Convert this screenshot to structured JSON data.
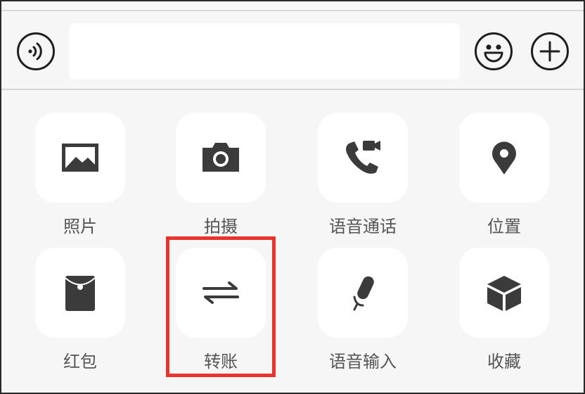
{
  "input_bar": {
    "voice_icon": "voice-wave-icon",
    "message_value": "",
    "emoji_icon": "smiley-face-icon",
    "more_icon": "plus-circle-icon"
  },
  "panel": {
    "items": [
      {
        "label": "照片",
        "icon": "image-icon"
      },
      {
        "label": "拍摄",
        "icon": "camera-icon"
      },
      {
        "label": "语音通话",
        "icon": "phone-video-icon"
      },
      {
        "label": "位置",
        "icon": "location-pin-icon"
      },
      {
        "label": "红包",
        "icon": "red-envelope-icon"
      },
      {
        "label": "转账",
        "icon": "transfer-arrows-icon"
      },
      {
        "label": "语音输入",
        "icon": "microphone-icon"
      },
      {
        "label": "收藏",
        "icon": "favorites-cube-icon"
      }
    ]
  },
  "colors": {
    "background": "#f6f6f6",
    "tile": "#ffffff",
    "icon": "#3b3b3b",
    "label": "#555555",
    "highlight": "#e8332f"
  }
}
